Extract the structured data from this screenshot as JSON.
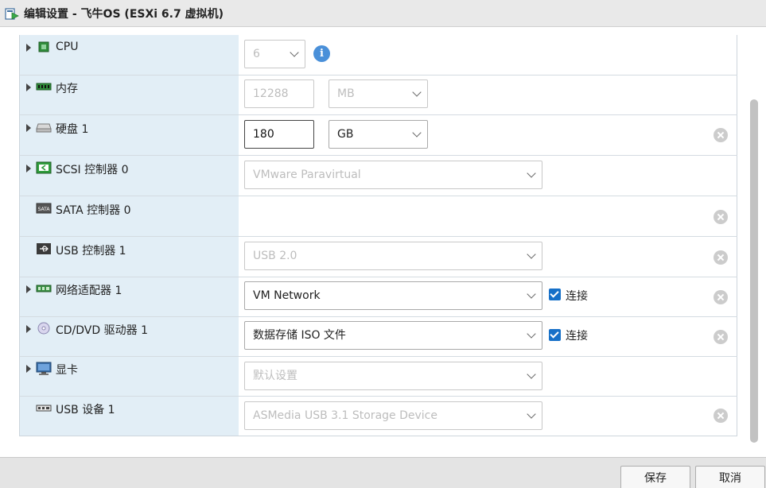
{
  "window": {
    "title": "编辑设置 - 飞牛OS (ESXi 6.7 虚拟机)"
  },
  "rows": [
    {
      "label": "CPU",
      "icon": "cpu-icon",
      "expandable": true,
      "value": "6"
    },
    {
      "label": "内存",
      "icon": "memory-icon",
      "expandable": true,
      "value": "12288",
      "unit": "MB"
    },
    {
      "label": "硬盘 1",
      "icon": "hard-disk-icon",
      "expandable": true,
      "value": "180",
      "unit": "GB"
    },
    {
      "label": "SCSI 控制器 0",
      "icon": "scsi-controller-icon",
      "expandable": true,
      "value": "VMware Paravirtual"
    },
    {
      "label": "SATA 控制器 0",
      "icon": "sata-controller-icon",
      "expandable": false,
      "icon_text": "SATA"
    },
    {
      "label": "USB 控制器 1",
      "icon": "usb-controller-icon",
      "expandable": false,
      "value": "USB 2.0"
    },
    {
      "label": "网络适配器 1",
      "icon": "network-adapter-icon",
      "expandable": true,
      "value": "VM Network",
      "connect_label": "连接",
      "connected": true
    },
    {
      "label": "CD/DVD 驱动器 1",
      "icon": "cd-dvd-icon",
      "expandable": true,
      "value": "数据存储 ISO 文件",
      "connect_label": "连接",
      "connected": true
    },
    {
      "label": "显卡",
      "icon": "video-card-icon",
      "expandable": true,
      "value": "默认设置"
    },
    {
      "label": "USB 设备 1",
      "icon": "usb-device-icon",
      "expandable": false,
      "value": "ASMedia USB 3.1 Storage Device"
    }
  ],
  "info_icon_glyph": "i",
  "footer": {
    "save_label": "保存",
    "cancel_label": "取消"
  },
  "colors": {
    "label_column": "#e2eef6",
    "checkbox": "#1670c8",
    "info": "#4a90d9"
  }
}
